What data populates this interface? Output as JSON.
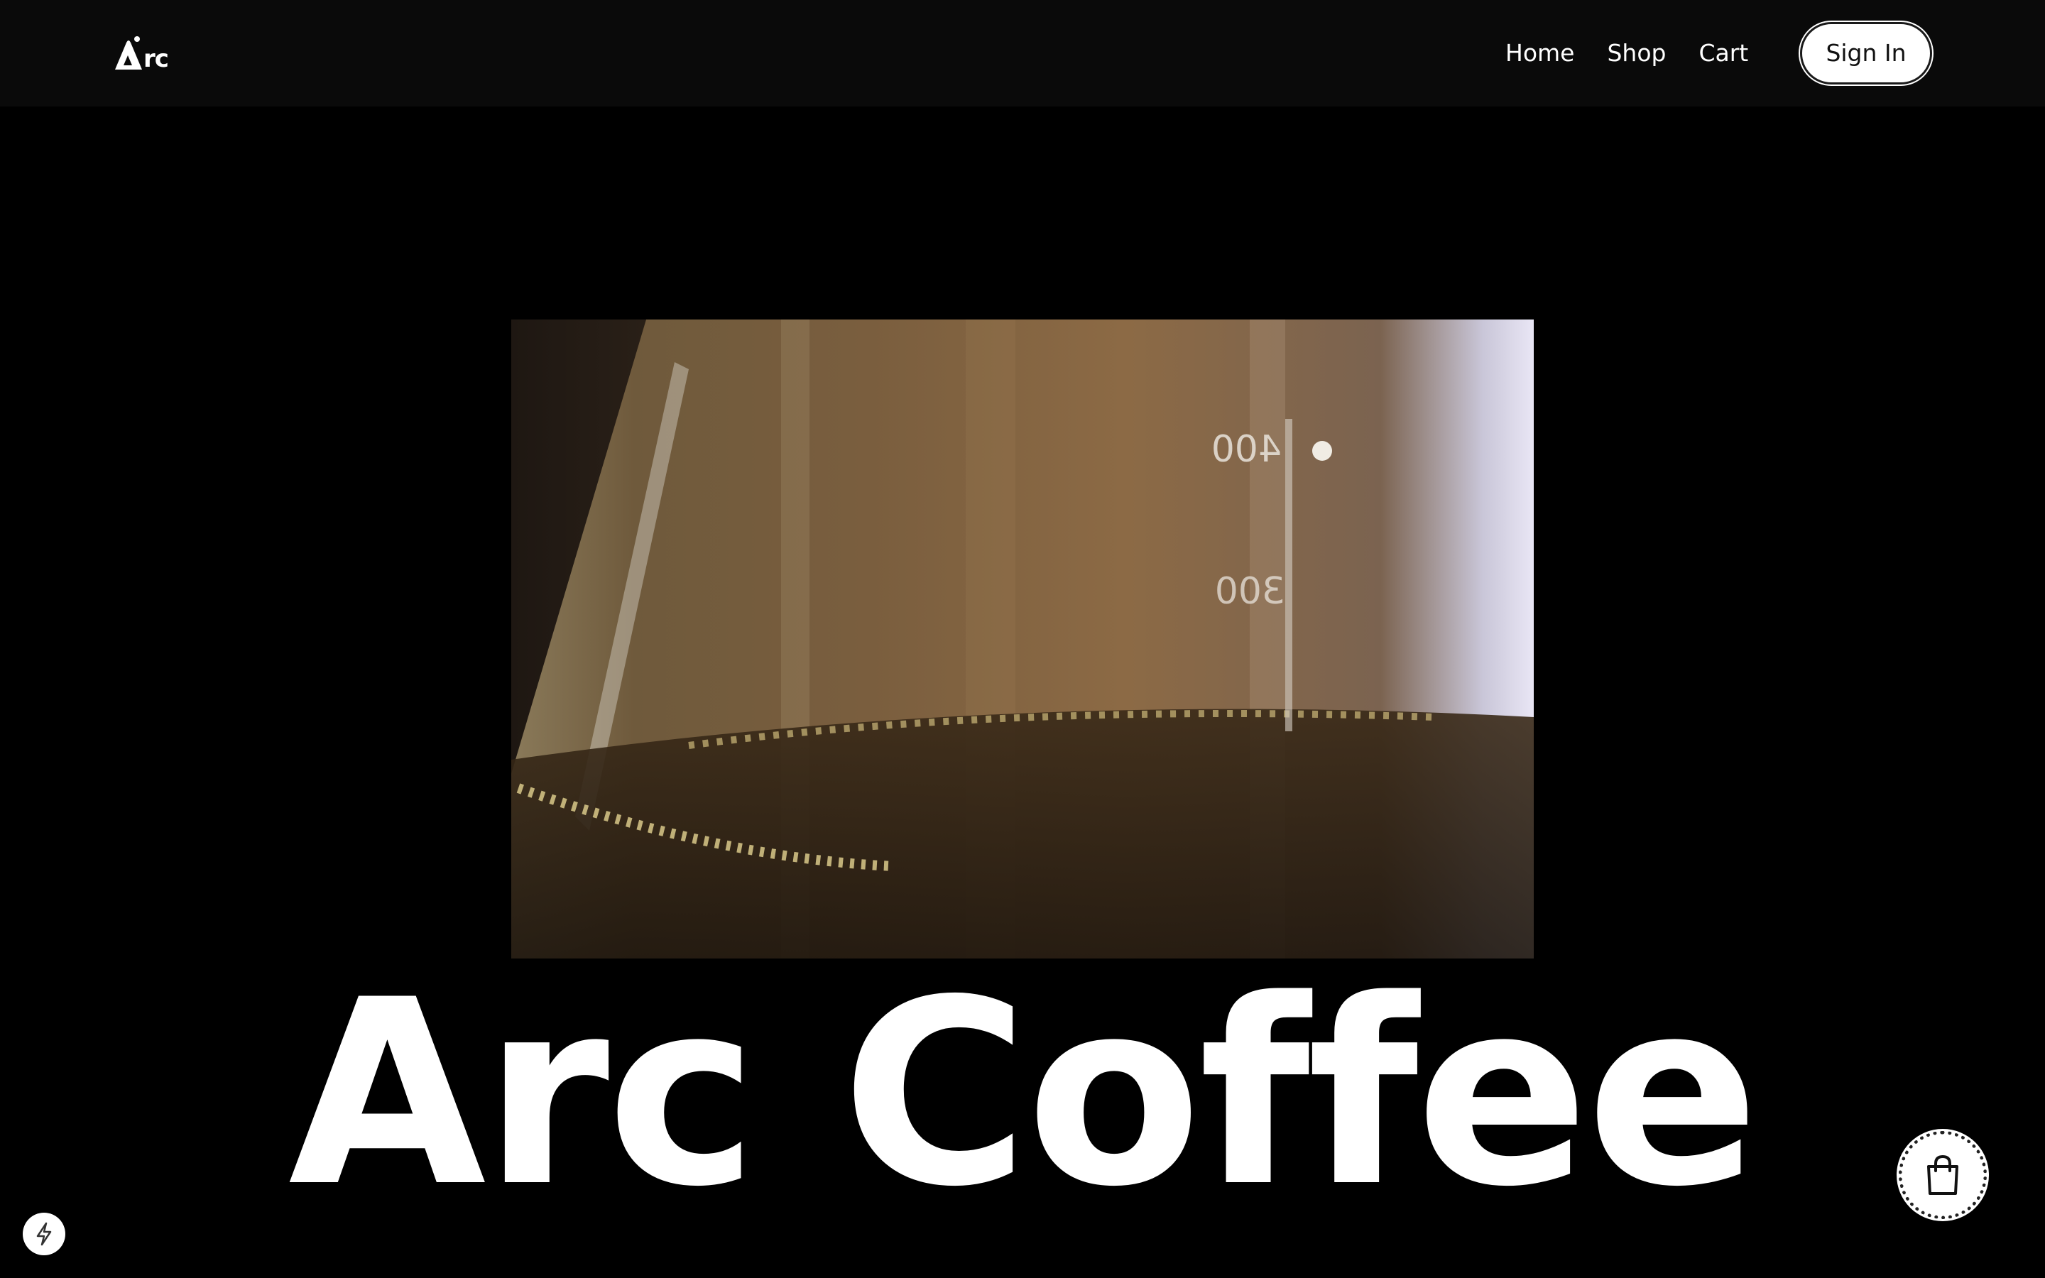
{
  "brand": {
    "logo_text": "rc"
  },
  "nav": {
    "links": [
      {
        "label": "Home"
      },
      {
        "label": "Shop"
      },
      {
        "label": "Cart"
      }
    ],
    "sign_in_label": "Sign In"
  },
  "hero": {
    "title": "Arc Coffee",
    "image": {
      "description_icon": "coffee-carafe-photo",
      "markings": [
        "400",
        "300"
      ]
    }
  },
  "floating": {
    "cart_icon": "shopping-bag-icon",
    "badge_icon": "lightning-bolt-icon"
  },
  "colors": {
    "background": "#000000",
    "header_background": "#0a0a0a",
    "text": "#ffffff",
    "button_background": "#ffffff",
    "button_text": "#111111"
  }
}
